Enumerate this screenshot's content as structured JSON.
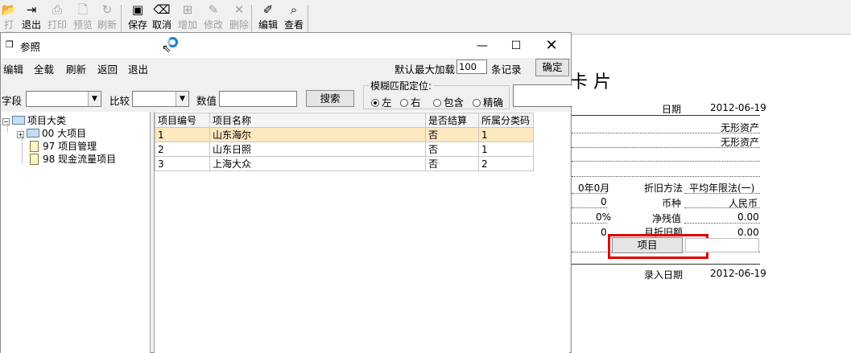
{
  "toolbar": {
    "items": [
      {
        "label": "打开",
        "icon": "open-icon",
        "enabled": false
      },
      {
        "label": "退出",
        "icon": "exit-icon",
        "enabled": true
      },
      {
        "label": "打印",
        "icon": "print-icon",
        "enabled": false
      },
      {
        "label": "预览",
        "icon": "preview-icon",
        "enabled": false
      },
      {
        "label": "刷新",
        "icon": "refresh-icon",
        "enabled": false
      },
      {
        "label": "保存",
        "icon": "save-icon",
        "enabled": true
      },
      {
        "label": "取消",
        "icon": "cancel-icon",
        "enabled": true
      },
      {
        "label": "增加",
        "icon": "add-icon",
        "enabled": false
      },
      {
        "label": "修改",
        "icon": "edit-icon",
        "enabled": false
      },
      {
        "label": "删除",
        "icon": "delete-icon",
        "enabled": false
      },
      {
        "label": "编辑",
        "icon": "edit-doc-icon",
        "enabled": true
      },
      {
        "label": "查看",
        "icon": "view-icon",
        "enabled": true
      }
    ]
  },
  "card": {
    "title_fragment": "卡 片",
    "date_label": "日期",
    "date_value": "2012-06-19",
    "row1_value": "无形资产",
    "row2_value": "无形资产",
    "life_value": "0年0月",
    "depr_method_label": "折旧方法",
    "depr_method_value": "平均年限法(一)",
    "zero_value": "0",
    "currency_label": "币种",
    "currency_value": "人民币",
    "rate_value": "0%",
    "net_residual_label": "净残值",
    "net_residual_value": "0.00",
    "monthly_depr_value": "0",
    "monthly_depr_label": "月折旧额",
    "monthly_depr_amount": "0.00",
    "project_button": "项目",
    "entry_date_label": "录入日期",
    "entry_date_value": "2012-06-19",
    "highlight_color": "#e00000"
  },
  "dialog": {
    "title": "参照",
    "menu": [
      "编辑",
      "全载",
      "刷新",
      "返回",
      "退出"
    ],
    "max_load_label": "默认最大加载",
    "max_load_value": "100",
    "records_label": "条记录",
    "confirm_button": "确定",
    "search": {
      "field_label": "字段",
      "compare_label": "比较",
      "value_label": "数值",
      "search_button": "搜索",
      "fuzzy_label": "模糊匹配定位:",
      "options": [
        "左",
        "右",
        "包含",
        "精确"
      ],
      "selected": "左"
    },
    "tree": {
      "root": "项目大类",
      "children": [
        {
          "code": "00",
          "name": "大项目"
        },
        {
          "code": "97",
          "name": "项目管理"
        },
        {
          "code": "98",
          "name": "现金流量项目"
        }
      ]
    },
    "grid": {
      "columns": [
        "项目编号",
        "项目名称",
        "是否结算",
        "所属分类码"
      ],
      "rows": [
        [
          "1",
          "山东海尔",
          "否",
          "1"
        ],
        [
          "2",
          "山东日照",
          "否",
          "1"
        ],
        [
          "3",
          "上海大众",
          "否",
          "2"
        ]
      ],
      "selected_row": 0
    }
  }
}
